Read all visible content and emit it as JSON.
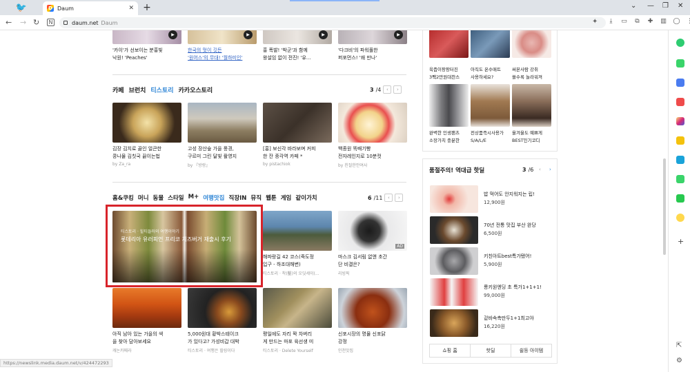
{
  "browser": {
    "tab_title": "Daum",
    "favicon_letter": "D",
    "url": "daum.net",
    "url_suffix": "Daum",
    "status_url": "https://newslink.media.daum.net/v/424472293"
  },
  "top_row": [
    {
      "caption1": "'카이'가 선보이는 분홍빛",
      "caption2": "낙원! 'Peaches'"
    },
    {
      "caption1": "한국의 멋이 깃든",
      "caption2": "'원어스'의 무대! '월하미인'"
    },
    {
      "caption1": "홍 폭발! '박군'과 함께",
      "caption2": "왕설임 없이 전진! '유..."
    },
    {
      "caption1": "'다크비'의 파워풀한",
      "caption2": "퍼포먼스! '왜 만나'"
    }
  ],
  "section1": {
    "tabs": [
      "카페",
      "브런치",
      "티스토리",
      "카카오스토리"
    ],
    "selected": "티스토리",
    "page": "3",
    "total": "/4",
    "items": [
      {
        "c1": "김장 김치로 끓인 얼큰한",
        "c2": "콩나물 김칫국 끓이는법",
        "src": "by Za_ra"
      },
      {
        "c1": "고성 장산숲 가을 풍경,",
        "c2": "구르미 그린 달빛 촬영지",
        "src": "by 『방랑』"
      },
      {
        "c1": "[홍] 보신각 바라보며 커피",
        "c2": "한 잔 종각역 카페 *",
        "src": "by pistachiok"
      },
      {
        "c1": "백종원 똑배기빵",
        "c2": "전자레인지로 10분컷",
        "src": "by 친절한안여사"
      }
    ]
  },
  "section2": {
    "tabs": [
      "홈&쿠킹",
      "머니",
      "동물",
      "스타일",
      "M+",
      "여행맛집",
      "직장IN",
      "뮤직",
      "웹툰",
      "게임",
      "같이가치"
    ],
    "selected": "여행맛집",
    "page": "6",
    "total": "/11",
    "featured": {
      "category": "티스토리 · 힐티들러의 여행이야기",
      "title": "롯데리아 유러피언 프리코 치즈버거 재출시 후기"
    },
    "items_top": [
      {
        "c1": "해파랑길 42 코스(죽도정",
        "c2": "입구 - 하조대해변)",
        "src": "티스토리 · 착(鑿)의 오딧세이(..."
      },
      {
        "c1": "마스크 김서림 없앤 초간",
        "c2": "단 비결은?",
        "src": "리빙픽"
      }
    ],
    "items_bottom": [
      {
        "c1": "아직 남아 있는 가을의 색",
        "c2": "을 찾아 담아보세요",
        "src": "캐논카메라"
      },
      {
        "c1": "5,000원대 황박스테이크",
        "c2": "가 있다고? 가성비갑 대박",
        "src": "티스토리 · 여행은 힐링이다"
      },
      {
        "c1": "평일에도 자리 꽉 차버리",
        "c2": "게 만드는 마포 육선생 미",
        "src": "티스토리 · Delete Yourself"
      },
      {
        "c1": "신포시장의 명물 신포닭",
        "c2": "강정",
        "src": "인천맛집"
      }
    ],
    "ad_label": "AD"
  },
  "shopping_top": [
    {
      "c1": "육즙이팡팡터진",
      "c2": "3팩2만원대찬스"
    },
    {
      "c1": "아직도 온수매트",
      "c2": "사용하세요?"
    },
    {
      "c1": "써본사람 강취",
      "c2": "쓸수록 놀라워져"
    },
    {
      "c1": "완벽한 인생팬츠",
      "c2": "소장가치 충분한"
    },
    {
      "c1": "전상품즉시사용가",
      "c2": "S/A/L/E"
    },
    {
      "c1": "올겨울도 예쁘게",
      "c2": "BEST인기코디"
    }
  ],
  "hot_deals": {
    "title": "품절주의! 역대급 핫딜",
    "page": "3",
    "total": "/6",
    "items": [
      {
        "name": "밥 먹어도 안지워지는 립!",
        "price": "12,900원"
      },
      {
        "name": "70년 전통 맛집 부산 완당",
        "price": "6,500원"
      },
      {
        "name": "키친아트best특가됐어!",
        "price": "5,900원"
      },
      {
        "name": "롱키원엔딩 초 특가1+1+1!",
        "price": "99,000원"
      },
      {
        "name": "겉바속촉만두1+1최고야",
        "price": "16,220원"
      }
    ],
    "buttons": [
      "쇼핑 홈",
      "핫딜",
      "쉴등 아이템"
    ]
  },
  "colors": {
    "accent": "#2f86d6",
    "highlight": "#d8232a"
  }
}
